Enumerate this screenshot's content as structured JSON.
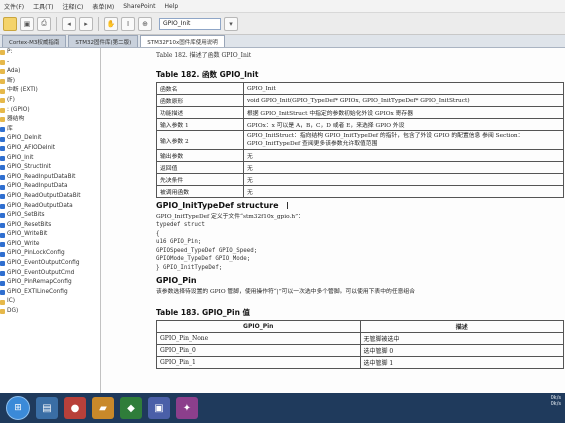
{
  "menubar": {
    "items": [
      "文件(F)",
      "工具(T)",
      "注释(C)",
      "表单(M)",
      "SharePoint",
      "Help"
    ]
  },
  "toolbar": {
    "search_value": "GPIO_Init"
  },
  "tabs": [
    {
      "label": "Cortex-M3权威指南"
    },
    {
      "label": "STM32固件库(第二版)"
    },
    {
      "label": "STM32F10x固件库使用说明"
    }
  ],
  "sidebar": {
    "items": [
      "P:",
      "-",
      "Ada)",
      "断)",
      "中断 (EXTI)",
      "(F)",
      ": (GPIO)",
      "器结构",
      "库",
      "GPIO_DeInit",
      "GPIO_AFIODeInit",
      "GPIO_Init",
      "GPIO_StructInit",
      "GPIO_ReadInputDataBit",
      "GPIO_ReadInputData",
      "GPIO_ReadOutputDataBit",
      "GPIO_ReadOutputData",
      "GPIO_SetBits",
      "GPIO_ResetBits",
      "GPIO_WriteBit",
      "GPIO_Write",
      "GPIO_PinLockConfig",
      "GPIO_EventOutputConfig",
      "GPIO_EventOutputCmd",
      "GPIO_PinRemapConfig",
      "GPIO_EXTILineConfig",
      "IC)",
      "DG)"
    ]
  },
  "doc": {
    "header": "Table 182. 描述了函数 GPIO_Init",
    "table182_title": "Table 182. 函数 GPIO_Init",
    "table182_rows": [
      [
        "函数名",
        "GPIO_Init"
      ],
      [
        "函数原形",
        "void GPIO_Init(GPIO_TypeDef* GPIOx, GPIO_InitTypeDef* GPIO_InitStruct)"
      ],
      [
        "功能描述",
        "根据 GPIO_InitStruct 中指定的参数初始化外设 GPIOx 寄存器"
      ],
      [
        "输入参数 1",
        "GPIOx：x 可以是 A，B，C，D 或者 E，来选择 GPIO 外设"
      ],
      [
        "输入参数 2",
        "GPIO_InitStruct：指向结构 GPIO_InitTypeDef 的指针，包含了外设 GPIO 的配置信息 参阅 Section：GPIO_InitTypeDef 查阅更多该参数允许取值范围"
      ],
      [
        "输出参数",
        "无"
      ],
      [
        "返回值",
        "无"
      ],
      [
        "先决条件",
        "无"
      ],
      [
        "被调用函数",
        "无"
      ]
    ],
    "struct_heading": "GPIO_InitTypeDef structure",
    "struct_def_line": "GPIO_InitTypeDef 定义于文件“stm32f10x_gpio.h”：",
    "code_lines": [
      "typedef struct",
      "{",
      "u16 GPIO_Pin;",
      "GPIOSpeed_TypeDef GPIO_Speed;",
      "GPIOMode_TypeDef GPIO_Mode;",
      "} GPIO_InitTypeDef;"
    ],
    "pin_heading": "GPIO_Pin",
    "pin_desc": "该参数选择待设置的 GPIO 管脚，使用操作符“|”可以一次选中多个管脚。可以使用下表中的任意组合",
    "table183_title": "Table 183. GPIO_Pin 值",
    "table183_headers": [
      "GPIO_Pin",
      "描述"
    ],
    "table183_rows": [
      [
        "GPIO_Pin_None",
        "无管脚被选中"
      ],
      [
        "GPIO_Pin_0",
        "选中管脚 0"
      ],
      [
        "GPIO_Pin_1",
        "选中管脚 1"
      ]
    ]
  },
  "tray": {
    "line1": "0k/s",
    "line2": "0k/s"
  }
}
